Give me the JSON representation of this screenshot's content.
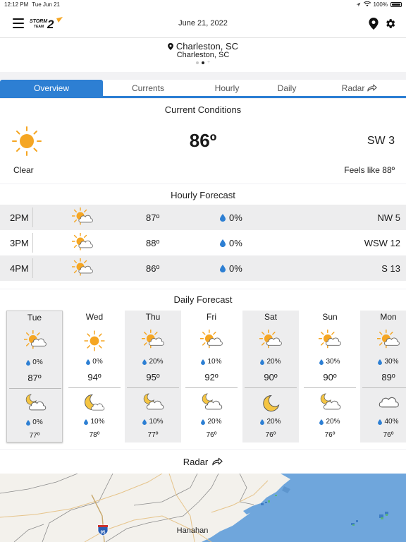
{
  "status_bar": {
    "time": "12:12 PM",
    "day": "Tue Jun 21",
    "battery": "100%"
  },
  "app_bar": {
    "date": "June 21, 2022",
    "logo_text": "STORM TEAM 2"
  },
  "location": {
    "primary": "Charleston, SC",
    "secondary": "Charleston, SC",
    "page_count": 2,
    "active_page": 2
  },
  "tabs": [
    {
      "label": "Overview",
      "active": true
    },
    {
      "label": "Currents",
      "active": false
    },
    {
      "label": "Hourly",
      "active": false
    },
    {
      "label": "Daily",
      "active": false
    },
    {
      "label": "Radar",
      "active": false
    }
  ],
  "current": {
    "title": "Current Conditions",
    "temp": "86º",
    "wind": "SW 3",
    "condition": "Clear",
    "feels_like": "Feels like 88º",
    "icon": "sun-icon"
  },
  "hourly": {
    "title": "Hourly Forecast",
    "rows": [
      {
        "time": "2PM",
        "icon": "partly-cloudy-icon",
        "temp": "87º",
        "precip": "0%",
        "wind": "NW 5"
      },
      {
        "time": "3PM",
        "icon": "partly-cloudy-icon",
        "temp": "88º",
        "precip": "0%",
        "wind": "WSW 12"
      },
      {
        "time": "4PM",
        "icon": "partly-cloudy-icon",
        "temp": "86º",
        "precip": "0%",
        "wind": "S 13"
      }
    ]
  },
  "daily": {
    "title": "Daily Forecast",
    "days": [
      {
        "name": "Tue",
        "day_icon": "partly-cloudy-icon",
        "day_precip": "0%",
        "high": "87º",
        "night_icon": "partly-cloudy-night-icon",
        "night_precip": "0%",
        "low": "77º"
      },
      {
        "name": "Wed",
        "day_icon": "sun-icon",
        "day_precip": "0%",
        "high": "94º",
        "night_icon": "moon-cloud-icon",
        "night_precip": "10%",
        "low": "78º"
      },
      {
        "name": "Thu",
        "day_icon": "partly-cloudy-icon",
        "day_precip": "20%",
        "high": "95º",
        "night_icon": "partly-cloudy-night-icon",
        "night_precip": "10%",
        "low": "77º"
      },
      {
        "name": "Fri",
        "day_icon": "partly-cloudy-icon",
        "day_precip": "10%",
        "high": "92º",
        "night_icon": "partly-cloudy-night-icon",
        "night_precip": "20%",
        "low": "76º"
      },
      {
        "name": "Sat",
        "day_icon": "partly-cloudy-icon",
        "day_precip": "20%",
        "high": "90º",
        "night_icon": "moon-icon",
        "night_precip": "20%",
        "low": "76º"
      },
      {
        "name": "Sun",
        "day_icon": "partly-cloudy-icon",
        "day_precip": "30%",
        "high": "90º",
        "night_icon": "partly-cloudy-night-icon",
        "night_precip": "20%",
        "low": "76º"
      },
      {
        "name": "Mon",
        "day_icon": "partly-cloudy-icon",
        "day_precip": "30%",
        "high": "89º",
        "night_icon": "cloud-icon",
        "night_precip": "40%",
        "low": "76º"
      }
    ]
  },
  "radar": {
    "label": "Radar",
    "map_labels": {
      "city": "Hanahan",
      "interstate": "95"
    }
  },
  "colors": {
    "accent": "#2d7fd3",
    "sun": "#f5a623",
    "rain_drop": "#2d7fd3",
    "ocean": "#6fa6dc",
    "land": "#f3f1ec"
  }
}
